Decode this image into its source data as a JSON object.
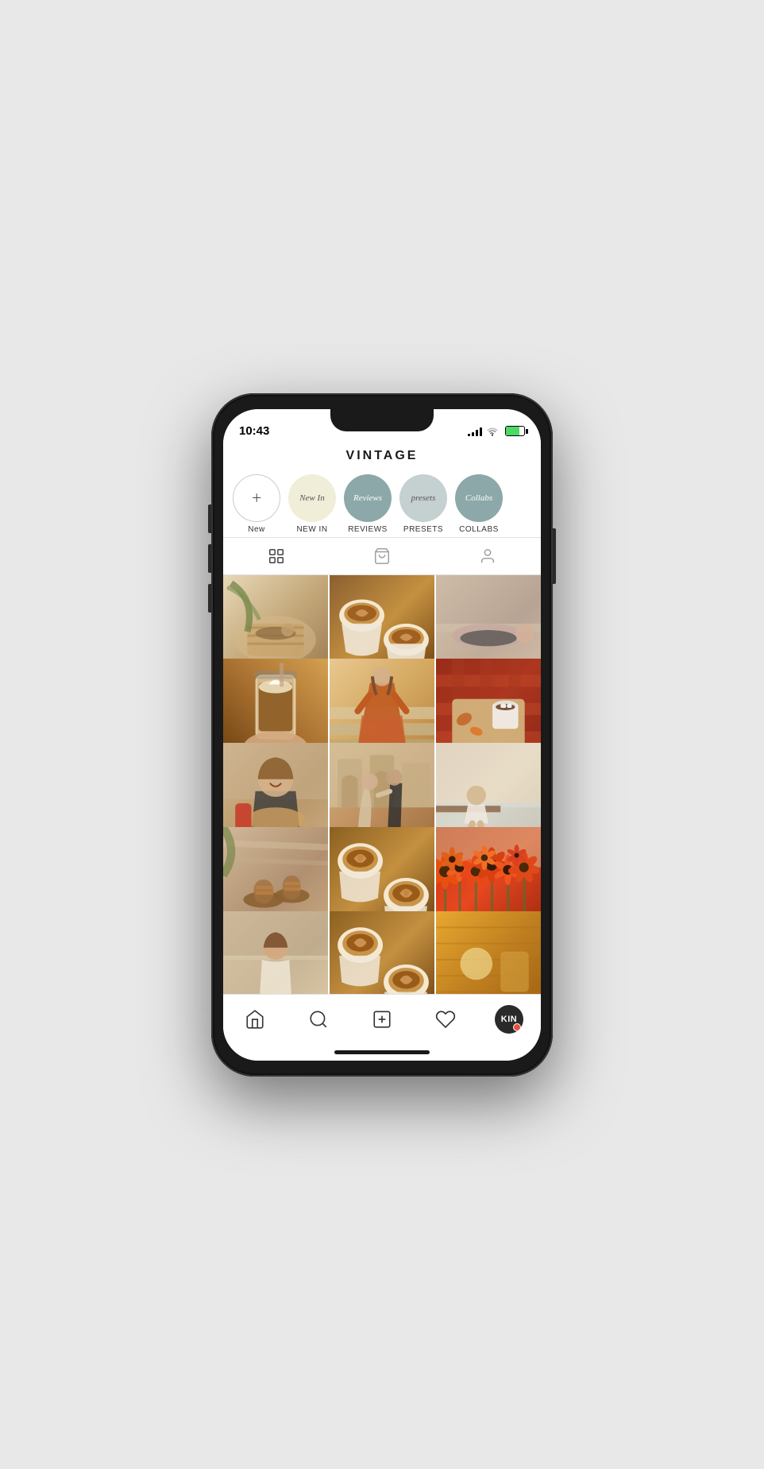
{
  "status": {
    "time": "10:43",
    "signal_bars": [
      3,
      5,
      8,
      11,
      13
    ],
    "battery_percent": 75
  },
  "header": {
    "title": "VINTAGE"
  },
  "stories": [
    {
      "id": "new",
      "type": "add",
      "label": "New"
    },
    {
      "id": "new-in",
      "type": "new-in",
      "label": "NEW IN",
      "text": "New In"
    },
    {
      "id": "reviews",
      "type": "reviews",
      "label": "REVIEWS",
      "text": "Reviews"
    },
    {
      "id": "presets",
      "type": "presets",
      "label": "PRESETS",
      "text": "presets"
    },
    {
      "id": "collabs",
      "type": "collabs",
      "label": "COLLABS",
      "text": "Collabs"
    }
  ],
  "tabs": [
    {
      "id": "grid",
      "icon": "grid-icon",
      "active": true
    },
    {
      "id": "shop",
      "icon": "shop-icon",
      "active": false
    },
    {
      "id": "tagged",
      "icon": "tagged-icon",
      "active": false
    }
  ],
  "grid": {
    "rows": 5,
    "cols": 3,
    "cells": [
      "cell-1",
      "cell-2",
      "cell-3",
      "cell-4",
      "cell-5",
      "cell-6",
      "cell-7",
      "cell-8",
      "cell-9",
      "cell-10",
      "cell-11",
      "cell-12",
      "cell-13",
      "cell-14",
      "cell-15"
    ]
  },
  "bottom_nav": [
    {
      "id": "home",
      "icon": "home-icon"
    },
    {
      "id": "search",
      "icon": "search-icon"
    },
    {
      "id": "add-post",
      "icon": "add-post-icon"
    },
    {
      "id": "likes",
      "icon": "heart-icon"
    },
    {
      "id": "profile",
      "icon": "profile-icon",
      "text": "KIN"
    }
  ],
  "colors": {
    "accent": "#e8503a",
    "background": "#ffffff",
    "text_primary": "#1a1a1a",
    "story_new_in_bg": "#f0edd8",
    "story_teal_bg": "#8ca8a8",
    "story_light_teal_bg": "#c5d0d0"
  }
}
